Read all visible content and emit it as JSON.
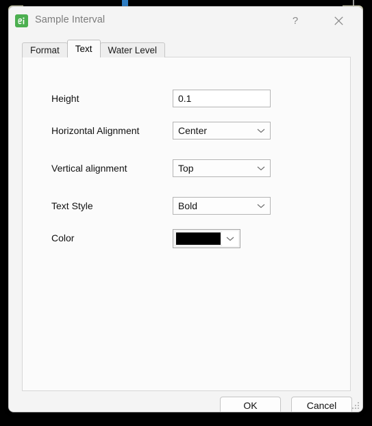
{
  "window": {
    "title": "Sample Interval",
    "icon": "app-green-icon",
    "help_label": "?",
    "close_label": "close-icon"
  },
  "tabs": [
    {
      "label": "Format",
      "selected": false
    },
    {
      "label": "Text",
      "selected": true
    },
    {
      "label": "Water Level",
      "selected": false
    }
  ],
  "form": {
    "rows": [
      {
        "label": "Height",
        "control": "text",
        "value": "0.1"
      },
      {
        "label": "Horizontal Alignment",
        "control": "combo",
        "value": "Center"
      },
      {
        "label": "Vertical alignment",
        "control": "combo",
        "value": "Top"
      },
      {
        "label": "Text Style",
        "control": "combo",
        "value": "Bold"
      },
      {
        "label": "Color",
        "control": "color",
        "value": "#000000"
      }
    ]
  },
  "footer": {
    "ok_label": "OK",
    "cancel_label": "Cancel"
  },
  "colors": {
    "accent_green": "#4caf50",
    "dialog_background": "#f4f4f4",
    "panel_background": "#fbfbfb",
    "text": "#101010",
    "title_text": "#7b7b7b",
    "swatch": "#000000"
  }
}
